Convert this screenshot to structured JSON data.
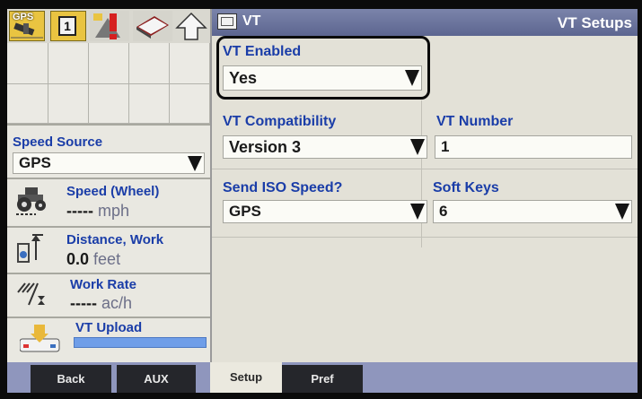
{
  "status_icons": {
    "gps_label": "GPS",
    "counter_label": "1",
    "icon_names": [
      "gps-satellite-icon",
      "counter-icon",
      "alert-icon",
      "book-icon",
      "up-arrow-icon"
    ]
  },
  "left_panel": {
    "speed_source": {
      "title": "Speed Source",
      "value": "GPS"
    },
    "speed_wheel": {
      "title": "Speed (Wheel)",
      "value": "-----",
      "unit": "mph"
    },
    "distance_work": {
      "title": "Distance, Work",
      "value": "0.0",
      "unit": "feet"
    },
    "work_rate": {
      "title": "Work Rate",
      "value": "-----",
      "unit": "ac/h"
    },
    "vt_upload": {
      "title": "VT Upload"
    }
  },
  "header": {
    "title": "VT",
    "subtitle": "VT Setups"
  },
  "form": {
    "vt_enabled": {
      "label": "VT Enabled",
      "value": "Yes"
    },
    "vt_compatibility": {
      "label": "VT Compatibility",
      "value": "Version 3"
    },
    "vt_number": {
      "label": "VT Number",
      "value": "1"
    },
    "send_iso_speed": {
      "label": "Send ISO Speed?",
      "value": "GPS"
    },
    "soft_keys": {
      "label": "Soft Keys",
      "value": "6"
    }
  },
  "tabs": [
    "Back",
    "AUX",
    "Setup",
    "Pref"
  ],
  "active_tab": "Setup",
  "colors": {
    "label_blue": "#1a3da8",
    "header_bar": "#6a739c",
    "tab_bar": "#8f96bd",
    "upload_bar": "#6f9ee8"
  }
}
